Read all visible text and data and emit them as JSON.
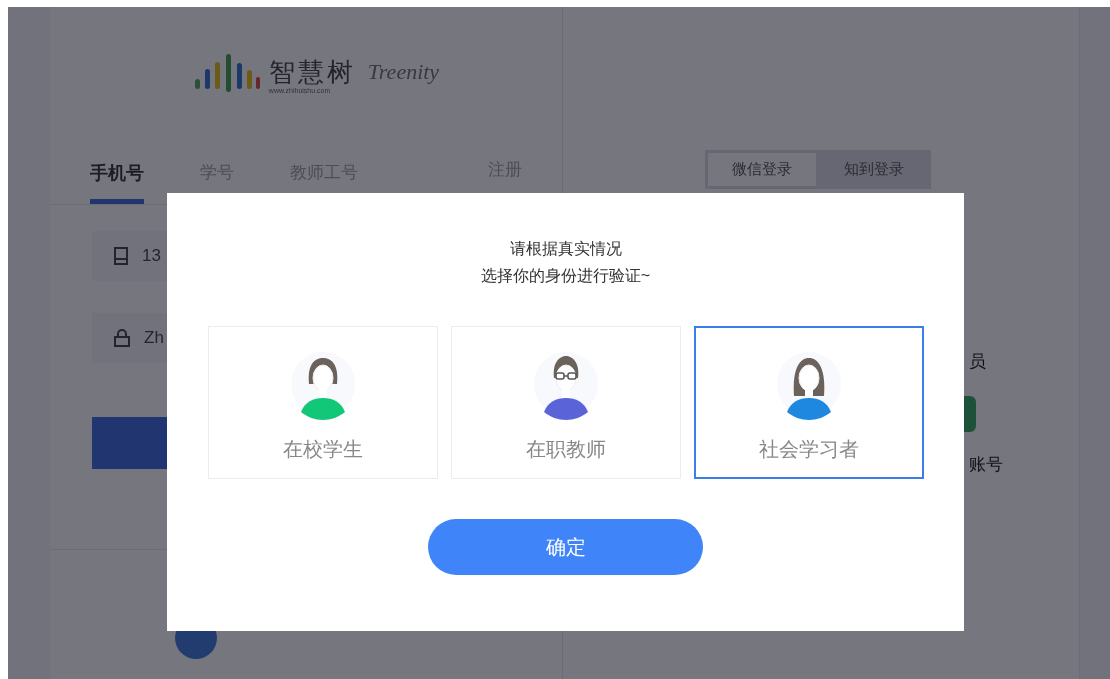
{
  "logo": {
    "name": "智慧树",
    "url": "www.zhihuishu.com",
    "brand": "Treenity"
  },
  "login_tabs": [
    {
      "label": "手机号",
      "selected": true
    },
    {
      "label": "学号",
      "selected": false
    },
    {
      "label": "教师工号",
      "selected": false
    }
  ],
  "register_link": "注册",
  "phone_field": {
    "value": "13"
  },
  "password_field": {
    "value": "Zh"
  },
  "login_methods": [
    {
      "label": "微信登录",
      "selected": true
    },
    {
      "label": "知到登录",
      "selected": false
    }
  ],
  "side_texts": [
    "员",
    "账号"
  ],
  "dialog": {
    "prompt_lines": [
      "请根据真实情况",
      "选择你的身份进行验证~"
    ],
    "options": [
      {
        "kind": "student",
        "label": "在校学生",
        "selected": false
      },
      {
        "kind": "teacher",
        "label": "在职教师",
        "selected": false
      },
      {
        "kind": "learner",
        "label": "社会学习者",
        "selected": true
      }
    ],
    "confirm_button": "确定"
  }
}
